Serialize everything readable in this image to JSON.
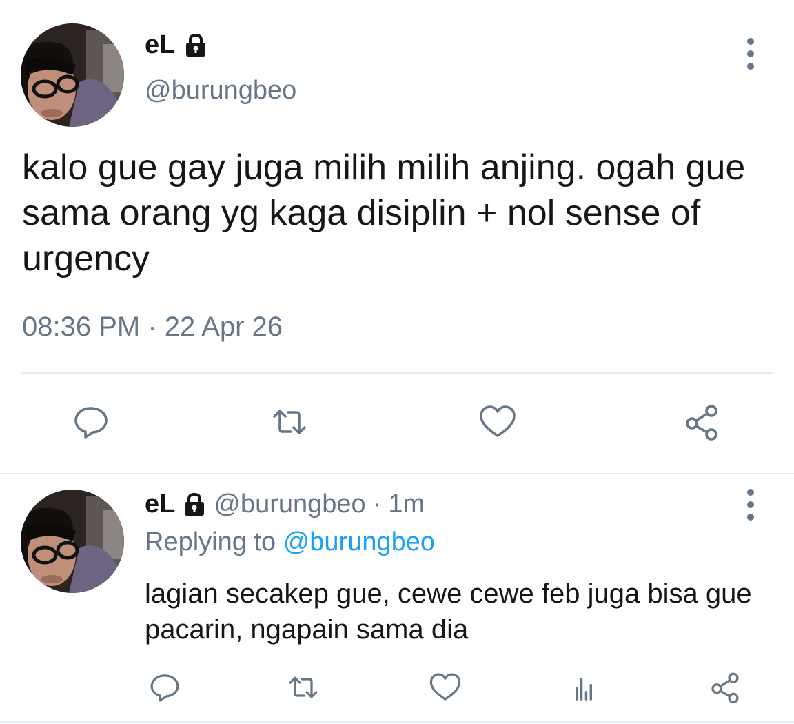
{
  "main_tweet": {
    "display_name": "eL",
    "handle": "@burungbeo",
    "text": "kalo gue gay juga milih milih anjing. ogah gue sama orang yg kaga disiplin + nol sense of urgency",
    "time": "08:36 PM",
    "separator": "·",
    "date": "22 Apr 26",
    "actions": [
      "reply-icon",
      "retweet-icon",
      "like-icon",
      "share-icon"
    ]
  },
  "reply_tweet": {
    "display_name": "eL",
    "handle": "@burungbeo",
    "separator": "·",
    "time": "1m",
    "replying_label": "Replying to",
    "replying_to": "@burungbeo",
    "text": "lagian secakep gue, cewe cewe feb juga bisa gue pacarin, ngapain sama dia",
    "actions": [
      "reply-icon",
      "retweet-icon",
      "like-icon",
      "analytics-icon",
      "share-icon"
    ]
  },
  "colors": {
    "text": "#14171a",
    "secondary": "#657786",
    "link": "#1da1f2",
    "divider": "#e6ecf0"
  }
}
